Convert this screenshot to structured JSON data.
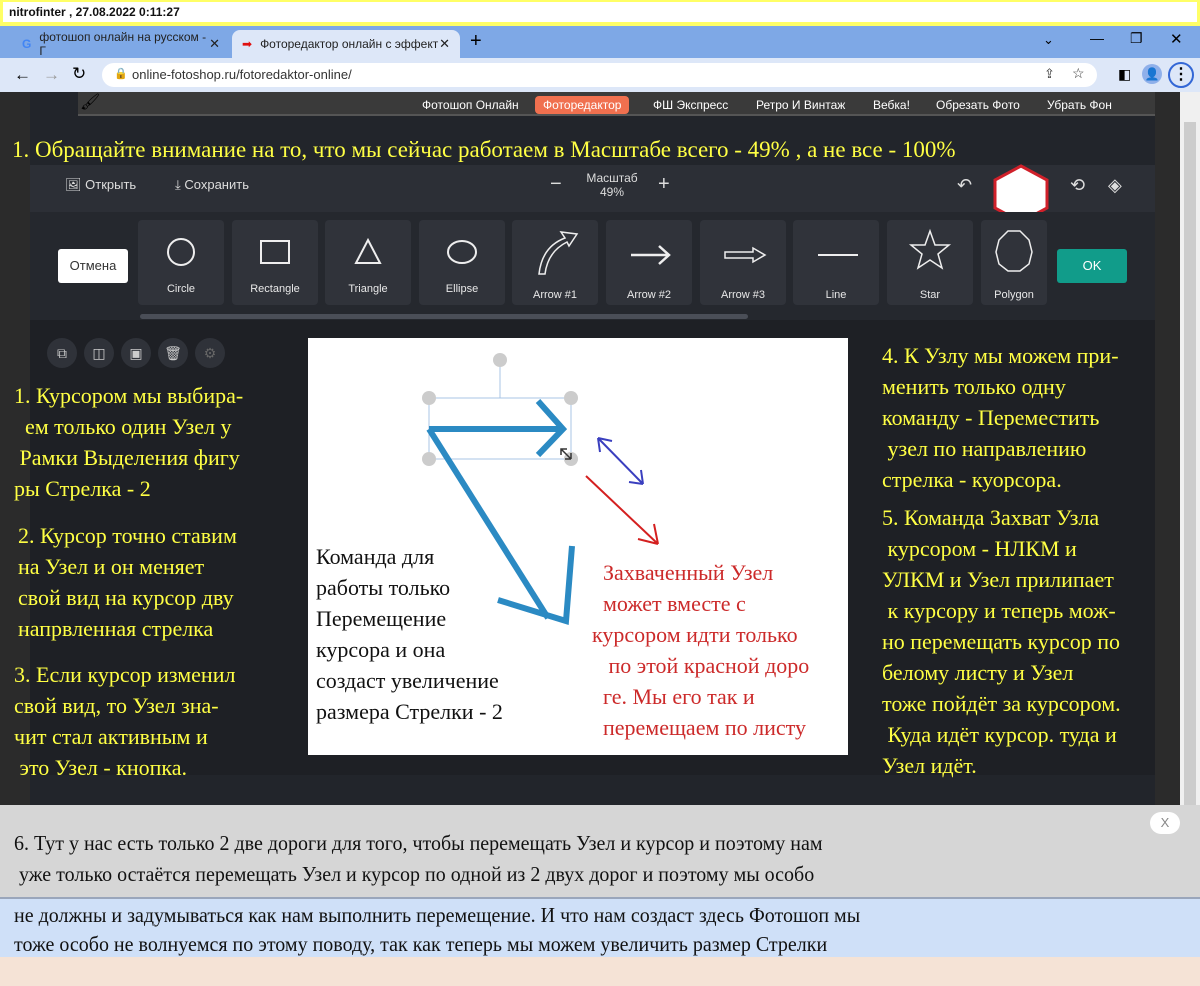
{
  "caption": "nitrofinter  ,  27.08.2022 0:11:27",
  "browser": {
    "tabs": [
      {
        "title": "фотошоп онлайн на русском - Г",
        "icon": "google-icon"
      },
      {
        "title": "Фоторедактор онлайн с эффект",
        "icon": "red-arrow-icon"
      }
    ],
    "url": "online-fotoshop.ru/fotoredaktor-online/"
  },
  "site_nav": [
    "Фотошоп Онлайн",
    "Фоторедактор",
    "ФШ Экспресс",
    "Ретро И Винтаж",
    "Вебка!",
    "Обрезать Фото",
    "Убрать Фон"
  ],
  "accent": "#f0704f",
  "toolbar": {
    "open": "Открыть",
    "save": "Сохранить",
    "zoom_label": "Масштаб",
    "zoom_value": "49%"
  },
  "shapes": {
    "cancel": "Отмена",
    "ok": "OK",
    "items": [
      "Circle",
      "Rectangle",
      "Triangle",
      "Ellipse",
      "Arrow #1",
      "Arrow #2",
      "Arrow #3",
      "Line",
      "Star",
      "Polygon"
    ]
  },
  "notes": {
    "top": "1. Обращайте внимание на то, что мы сейчас работаем в Масштабе всего - 49% , а не все - 100%",
    "n1": "1. Курсором мы выбира-\n  ем только один Узел у\n Рамки Выделения фигу\nры Стрелка - 2",
    "n2": "2. Курсор точно ставим\nна Узел и он меняет\nсвой вид на курсор дву\nнапрвленная стрелка",
    "n3": "3. Если курсор изменил\nсвой вид, то Узел зна-\nчит стал активным и\n это Узел - кнопка.",
    "n4": "4. К Узлу мы можем при-\nменить только одну\nкоманду - Переместить\n узел по направлению\nстрелка - куорсора.",
    "n5": "5. Команда Захват Узла\n курсором - НЛКМ и\nУЛКМ и Узел прилипает\n к курсору и теперь мож-\nно перемещать курсор по\nбелому листу и Узел\nтоже пойдёт за курсором.\n Куда идёт курсор. туда и\nУзел идёт.",
    "canvas_black": "Команда для\nработы только\nПеремещение\nкурсора и она\nсоздаст увеличение\nразмера Стрелки - 2",
    "canvas_red": "  Захваченный Узел\n  может вместе с\nкурсором идти только\n   по этой красной доро\n  ге. Мы его так и\n  перемещаем по листу",
    "b1": "6. Тут у нас есть только 2 две дороги для того, чтобы перемещать Узел и курсор и поэтому нам",
    "b2": " уже только остаётся перемещать Узел и курсор по одной из 2 двух дорог и поэтому мы особо",
    "b3": "не должны и задумываться как нам выполнить перемещение. И что нам создаст здесь Фотошоп мы",
    "b4": "тоже особо не волнуемся по этому поводу, так как теперь мы можем увеличить размер Стрелки",
    "close": "X"
  }
}
